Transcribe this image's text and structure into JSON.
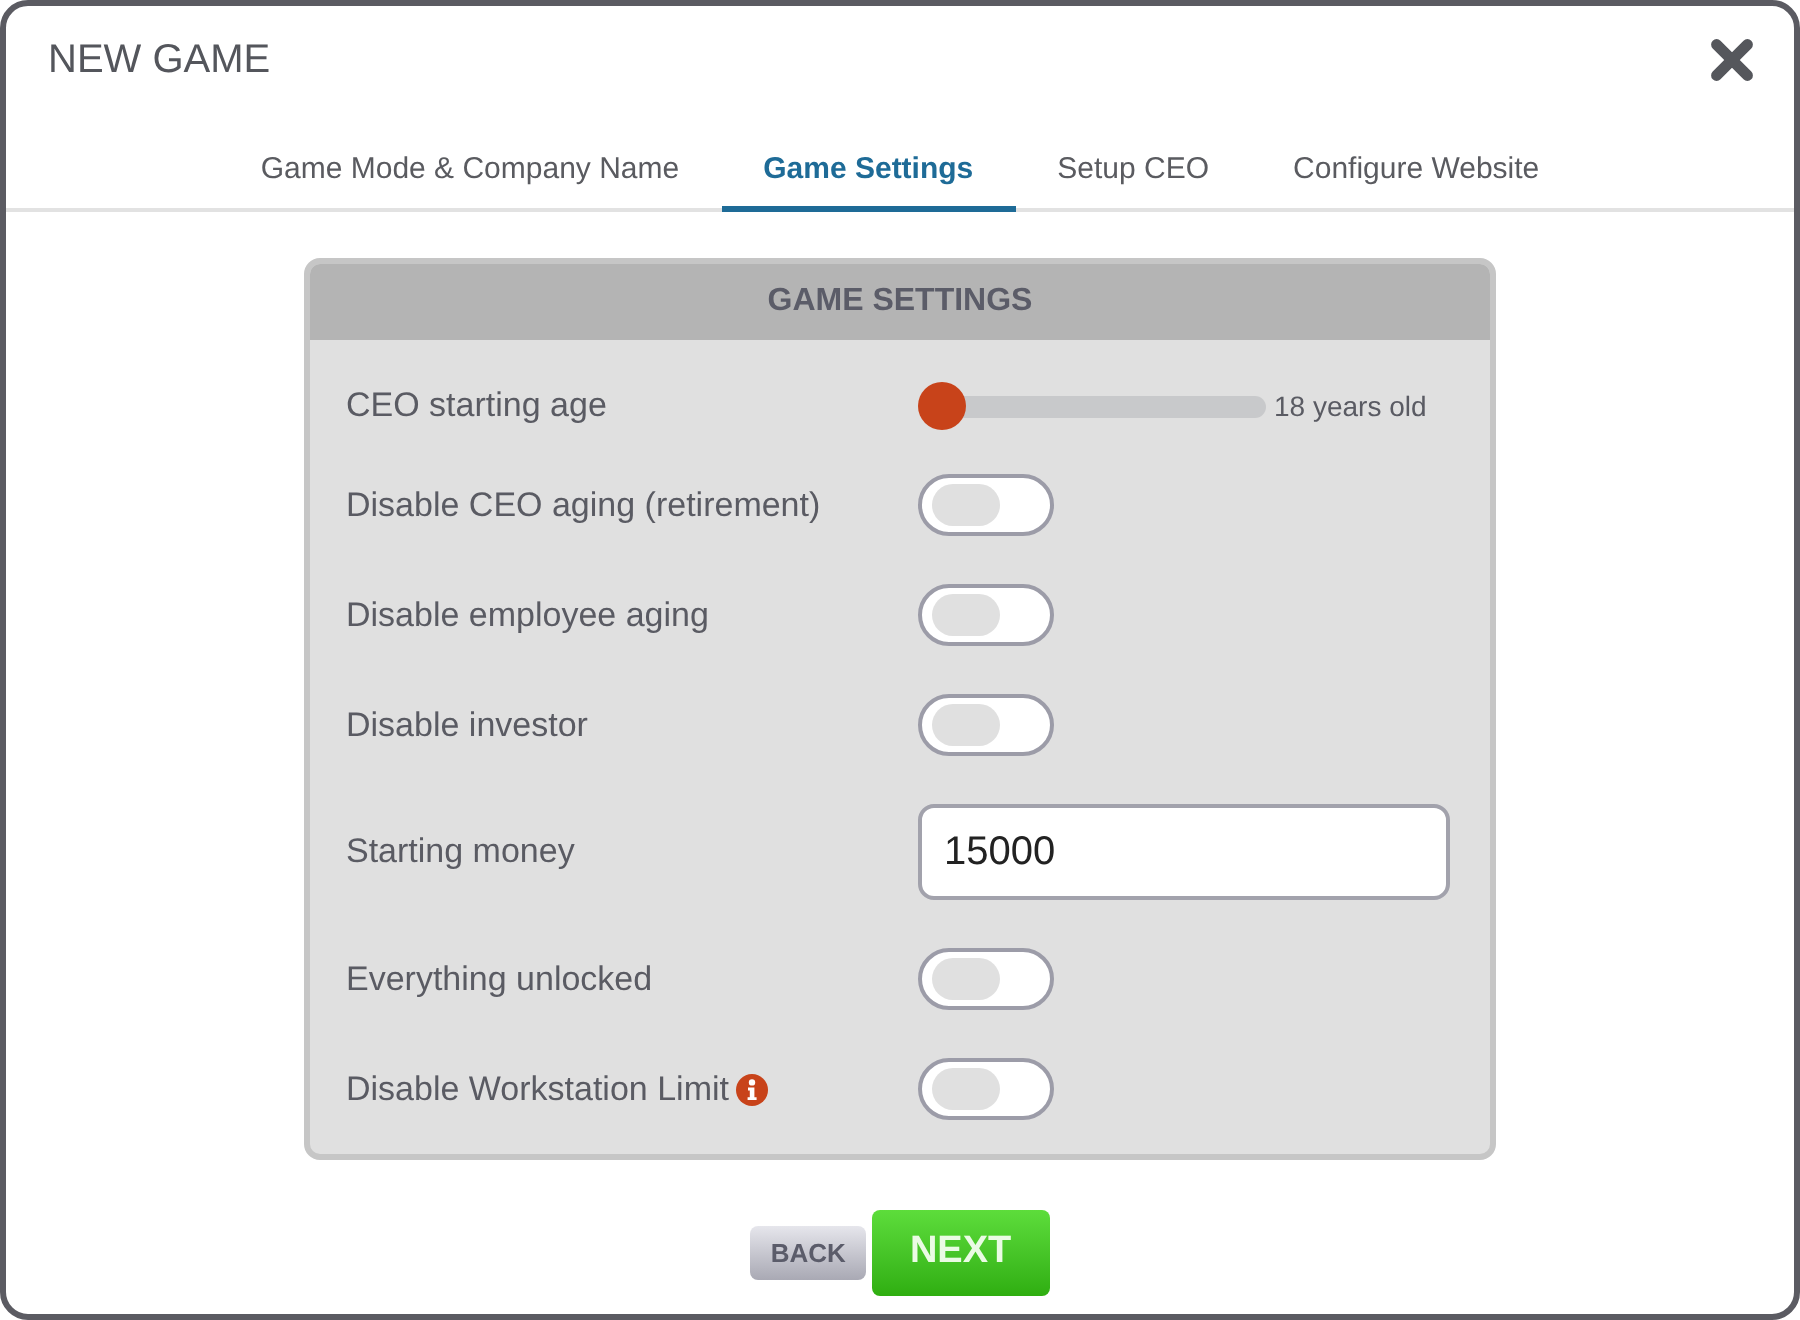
{
  "window": {
    "title": "NEW GAME"
  },
  "tabs": [
    {
      "label": "Game Mode & Company Name",
      "selected": false
    },
    {
      "label": "Game Settings",
      "selected": true
    },
    {
      "label": "Setup CEO",
      "selected": false
    },
    {
      "label": "Configure Website",
      "selected": false
    }
  ],
  "panel": {
    "title": "GAME SETTINGS",
    "settings": [
      {
        "kind": "slider",
        "label": "CEO starting age",
        "level": 0,
        "reading": "18 years old"
      },
      {
        "kind": "toggle",
        "label": "Disable CEO aging (retirement)",
        "on": false
      },
      {
        "kind": "toggle",
        "label": "Disable employee aging",
        "on": false
      },
      {
        "kind": "toggle",
        "label": "Disable investor",
        "on": false
      },
      {
        "kind": "input",
        "label": "Starting money",
        "value": "15000"
      },
      {
        "kind": "toggle",
        "label": "Everything unlocked",
        "on": false
      },
      {
        "kind": "toggle",
        "label": "Disable Workstation Limit",
        "on": false,
        "info": true
      }
    ]
  },
  "buttons": [
    {
      "label": "BACK",
      "kind": "secondary"
    },
    {
      "label": "NEXT",
      "kind": "primary"
    }
  ]
}
